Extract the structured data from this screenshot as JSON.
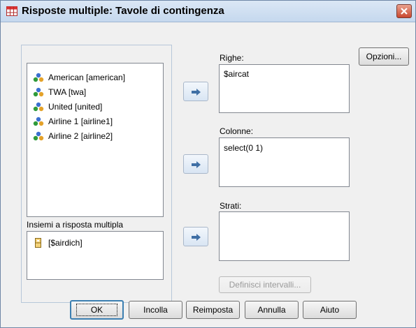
{
  "window": {
    "title": "Risposte multiple: Tavole di contingenza"
  },
  "variables": {
    "items": [
      {
        "label": "American [american]",
        "icon": "scale-nominal-icon"
      },
      {
        "label": "TWA [twa]",
        "icon": "scale-nominal-icon"
      },
      {
        "label": "United [united]",
        "icon": "scale-nominal-icon"
      },
      {
        "label": "Airline 1 [airline1]",
        "icon": "scale-nominal-icon"
      },
      {
        "label": "Airline 2 [airline2]",
        "icon": "scale-nominal-icon"
      }
    ]
  },
  "multiple_sets": {
    "label": "Insiemi a risposta multipla",
    "items": [
      {
        "label": "[$airdich]",
        "icon": "multiple-response-set-icon"
      }
    ]
  },
  "rows": {
    "label": "Righe:",
    "items": [
      "$aircat"
    ]
  },
  "columns": {
    "label": "Colonne:",
    "items": [
      "select(0 1)"
    ]
  },
  "layers": {
    "label": "Strati:",
    "items": []
  },
  "buttons": {
    "options": "Opzioni...",
    "define_ranges": "Definisci intervalli...",
    "ok": "OK",
    "paste": "Incolla",
    "reset": "Reimposta",
    "cancel": "Annulla",
    "help": "Aiuto"
  },
  "colors": {
    "title_bg": "#c5d8ee",
    "close_red": "#c9472f",
    "dialog_bg": "#f0f0f0"
  }
}
